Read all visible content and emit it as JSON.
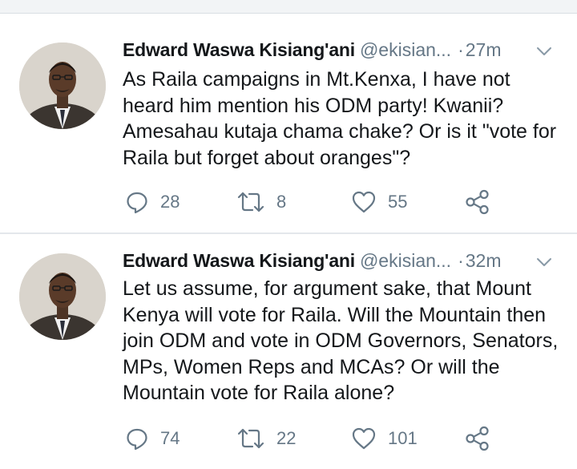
{
  "tweets": [
    {
      "author_name": "Edward Waswa Kisiang'ani",
      "handle": "@ekisian...",
      "separator": "·",
      "time": "27m",
      "text": "As Raila campaigns in Mt.Kenxa, I have not\nheard him mention  his ODM party! Kwanii?\nAmesahau kutaja chama chake? Or is it \"vote for\nRaila but forget about oranges\"?",
      "replies": "28",
      "retweets": "8",
      "likes": "55"
    },
    {
      "author_name": "Edward Waswa Kisiang'ani",
      "handle": "@ekisian...",
      "separator": "·",
      "time": "32m",
      "text": "Let us assume, for argument sake, that Mount\nKenya will vote for Raila. Will the Mountain then\njoin ODM and vote in ODM Governors, Senators,\nMPs, Women Reps and MCAs? Or will the\nMountain vote for Raila alone?",
      "replies": "74",
      "retweets": "22",
      "likes": "101"
    }
  ],
  "icons": {
    "reply": "reply-icon",
    "retweet": "retweet-icon",
    "like": "heart-icon",
    "share": "share-icon",
    "menu": "chevron-down-icon"
  },
  "colors": {
    "text": "#14171a",
    "muted": "#657786",
    "divider": "#e3e7eb",
    "top_band": "#f2f4f6"
  }
}
